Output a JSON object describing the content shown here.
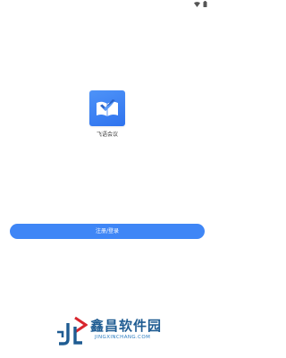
{
  "status_bar": {
    "icons": [
      "wifi-icon",
      "battery-icon"
    ]
  },
  "app": {
    "name": "飞语会议",
    "logo_icon": "feiyu-logo-icon",
    "logo_color": "#3b80f4"
  },
  "actions": {
    "register_login_label": "注册/登录",
    "button_color": "#3f86f6"
  },
  "watermark": {
    "title": "鑫昌软件园",
    "url": "JINGXINCHANG.COM"
  }
}
